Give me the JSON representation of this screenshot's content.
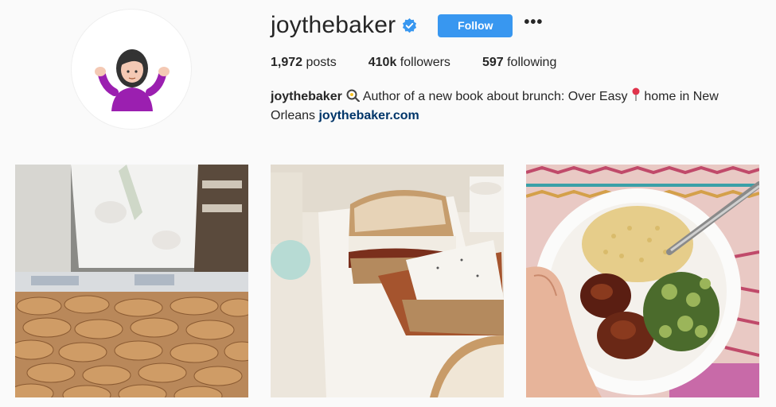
{
  "profile": {
    "username": "joythebaker",
    "follow_label": "Follow",
    "more_label": "•••",
    "avatar_icon": "shrugging-woman-emoji-icon",
    "verified_icon": "verified-badge-icon"
  },
  "stats": {
    "posts_count": "1,972",
    "posts_label": "posts",
    "followers_count": "410k",
    "followers_label": "followers",
    "following_count": "597",
    "following_label": "following"
  },
  "bio": {
    "name": "joythebaker",
    "text_before_pin": "Author of a new book about brunch: Over Easy ",
    "text_after_pin": "home in New Orleans",
    "link": "joythebaker.com",
    "pan_icon": "frying-pan-egg-icon",
    "pin_icon": "pushpin-icon"
  },
  "posts": [
    {
      "subject": "cannoli-tray"
    },
    {
      "subject": "bacon-sandwich"
    },
    {
      "subject": "quinoa-bowl"
    }
  ],
  "colors": {
    "accent": "#3897f0",
    "link": "#003569",
    "verified": "#3897f0"
  }
}
